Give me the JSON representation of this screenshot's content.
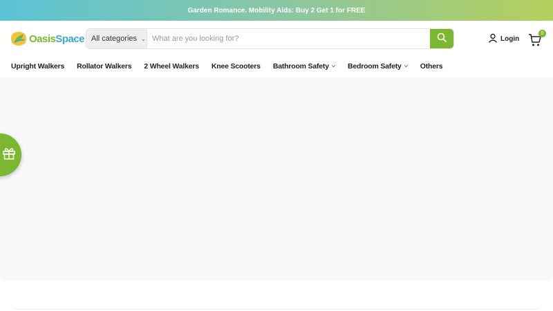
{
  "promo": {
    "text": "Garden Romance. Mobility Aids: Buy 2 Get 1 for FREE"
  },
  "header": {
    "logo": {
      "text_primary": "Oasis",
      "text_accent": "Space"
    },
    "search": {
      "category_label": "All categories",
      "placeholder": "What are you looking for?",
      "value": ""
    },
    "login_label": "Login",
    "cart_count": "0"
  },
  "nav": {
    "items": [
      {
        "label": "Upright Walkers",
        "has_dropdown": false
      },
      {
        "label": "Rollator Walkers",
        "has_dropdown": false
      },
      {
        "label": "2 Wheel Walkers",
        "has_dropdown": false
      },
      {
        "label": "Knee Scooters",
        "has_dropdown": false
      },
      {
        "label": "Bathroom Safety",
        "has_dropdown": true
      },
      {
        "label": "Bedroom Safety",
        "has_dropdown": true
      },
      {
        "label": "Others",
        "has_dropdown": false
      }
    ]
  },
  "colors": {
    "brand_green": "#7cb82f",
    "brand_blue": "#3aa9d6",
    "hero_bg": "#f8f8f8"
  },
  "icons": {
    "search": "search-icon",
    "user": "user-icon",
    "cart": "cart-icon",
    "gift": "gift-icon",
    "chevron": "chevron-down-icon"
  }
}
